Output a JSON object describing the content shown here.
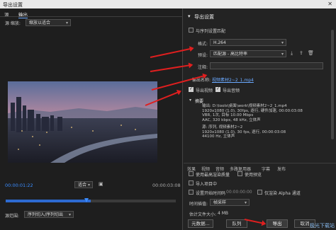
{
  "window": {
    "title": "导出设置",
    "close": "✕"
  },
  "left": {
    "tabs": [
      "源",
      "输出"
    ],
    "source_scaling_label": "源 缩放:",
    "source_scaling_value": "缩放以适合",
    "timecode_start": "00:00:01:22",
    "timecode_end": "00:00:03:08",
    "fit_value": "适合",
    "timeline_progress": 0.5,
    "source_range_label": "源范围:",
    "source_range_value": "序列切入/序列切出"
  },
  "right": {
    "export_settings_title": "导出设置",
    "match_sequence_label": "与序列设置匹配",
    "format_label": "格式:",
    "format_value": "H.264",
    "preset_label": "预设:",
    "preset_value": "匹配源 - 高比特率",
    "comment_label": "注释:",
    "output_name_label": "输出名称:",
    "output_name_value": "视频素材2~2_1.mp4",
    "export_video_label": "导出视频",
    "export_audio_label": "导出音频",
    "summary_title": "摘要",
    "summary_output": "输出: D:\\tools\\桌面\\work\\视频素材2~2_1.mp4\n1920x1080 (1.0), 30fps, 逐行, 硬件加速, 00:00:03:08\nVBR, 1次, 目标 10.00 Mbps\nAAC, 320 kbps, 48 kHz, 立体声",
    "summary_source": "源: 序列, 视频素材2~2\n1920x1080 (1.0), 30 fps, 逐行, 00:00:03:08\n44100 Hz, 立体声",
    "subtabs": [
      "效果",
      "视频",
      "音频",
      "多路复用器",
      "字幕",
      "发布"
    ],
    "use_max_render_label": "使用最高渲染质量",
    "use_previews_label": "使用预览",
    "import_project_label": "导入项目中",
    "set_start_timecode_label": "设置开始时间码",
    "start_timecode_value": "00:00:00:00",
    "render_alpha_label": "仅渲染 Alpha 通道",
    "time_interp_label": "时间插值:",
    "time_interp_value": "帧采样",
    "est_file_size_label": "估计文件大小:",
    "est_file_size_value": "4 MB",
    "btn_metadata": "元数据...",
    "btn_queue": "队列",
    "btn_export": "导出",
    "btn_cancel": "取消"
  },
  "watermark": "极光下载站",
  "colors": {
    "accent": "#3a8cff",
    "annotation": "#e01f1f",
    "bg": "#232323"
  },
  "icons": [
    "save-preset-icon",
    "import-preset-icon",
    "delete-preset-icon",
    "close-icon"
  ]
}
